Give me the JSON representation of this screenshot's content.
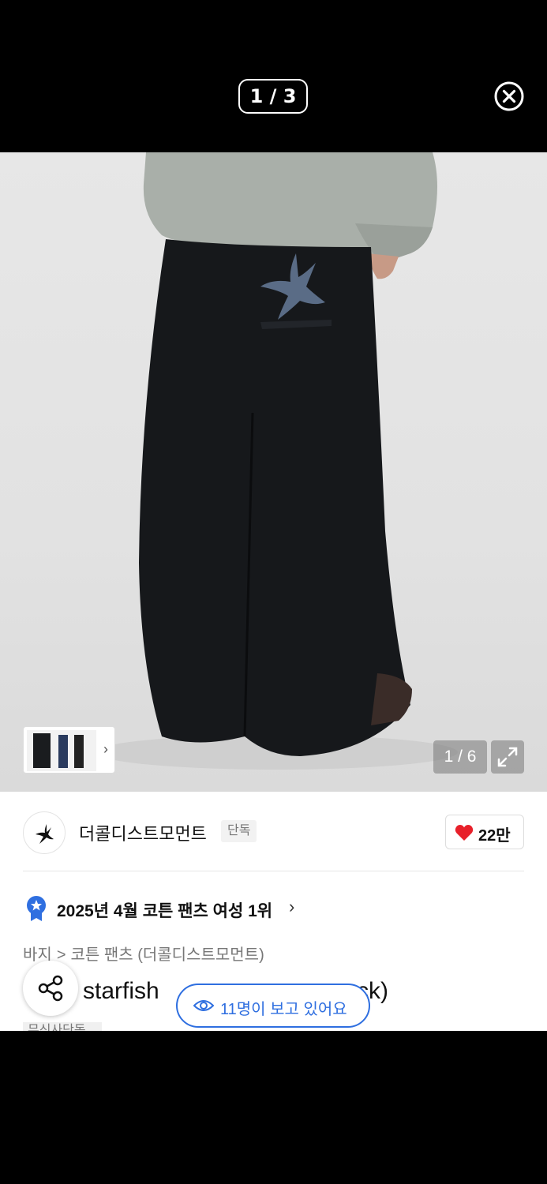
{
  "viewer": {
    "counter": "1 / 3"
  },
  "photo": {
    "page_indicator": "1 / 6"
  },
  "brand": {
    "name": "더콜디스트모먼트",
    "exclusive_badge": "단독",
    "likes": "22만"
  },
  "ranking": {
    "text": "2025년 4월 코튼 팬츠 여성 1위"
  },
  "breadcrumb": {
    "level1": "바지",
    "sep": ">",
    "level2": "코튼 팬츠 (더콜디스트모먼트)"
  },
  "product": {
    "title_start": "starfish",
    "title_end": "ck)"
  },
  "viewers_pill": {
    "text": "11명이 보고 있어요"
  },
  "badge": {
    "text": "무신사단독"
  },
  "colors": {
    "accent_blue": "#2f6fe0",
    "heart_red": "#e8202a",
    "pants_black": "#16181b",
    "sweatshirt_gray": "#a9afa9"
  },
  "icons": [
    "close-icon",
    "expand-icon",
    "heart-icon",
    "share-icon",
    "eye-icon",
    "ranking-badge-icon",
    "chevron-right-icon",
    "brand-logo-star-icon"
  ]
}
